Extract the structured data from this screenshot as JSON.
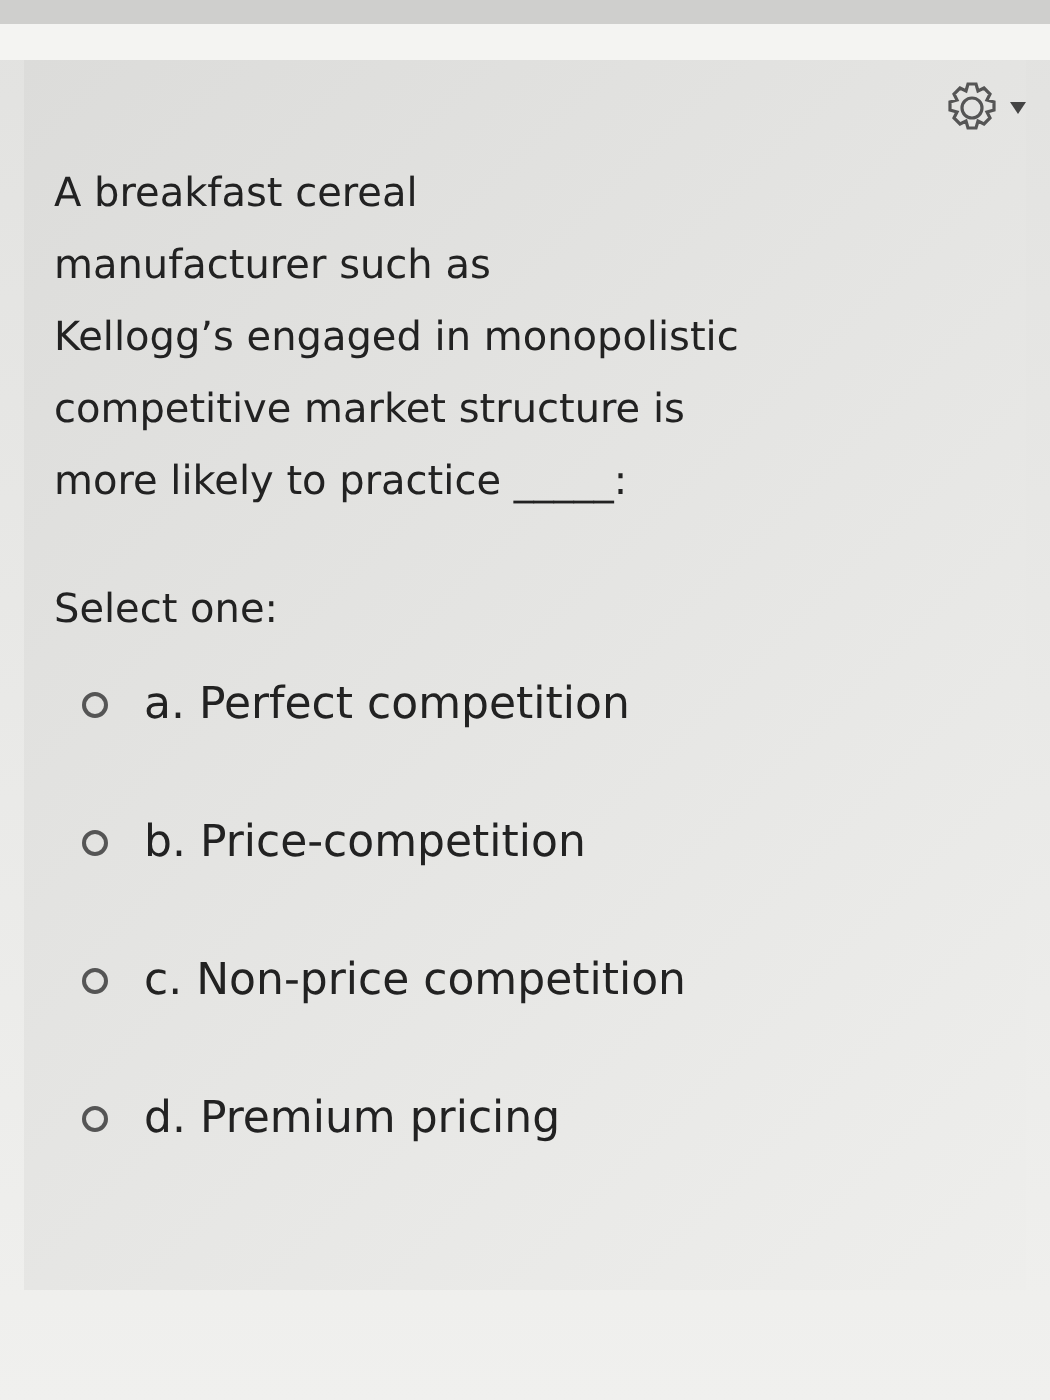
{
  "question": {
    "lines": [
      "A breakfast cereal",
      "manufacturer such as",
      "Kellogg’s engaged in monopolistic",
      "competitive market structure is",
      "more likely to practice _____:"
    ]
  },
  "prompt": "Select one:",
  "options": [
    {
      "label": "a. Perfect competition",
      "selected": false
    },
    {
      "label": "b. Price-competition",
      "selected": false
    },
    {
      "label": "c. Non-price competition",
      "selected": false
    },
    {
      "label": "d. Premium pricing",
      "selected": false
    }
  ]
}
